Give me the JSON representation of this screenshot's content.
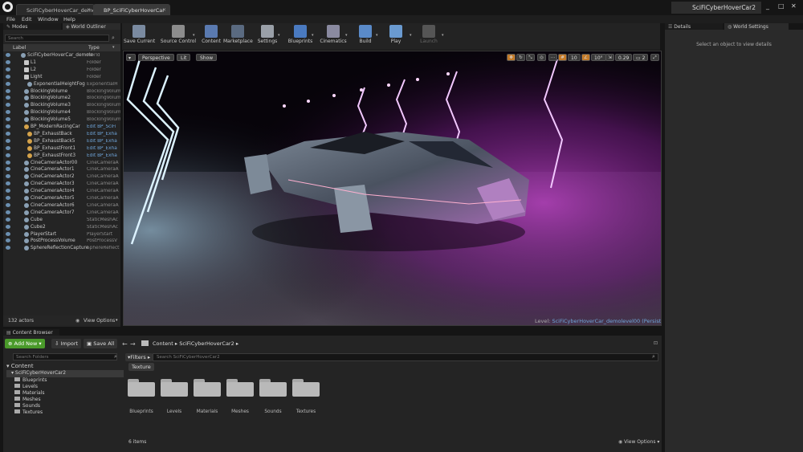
{
  "titlebar": {
    "tab_level": "SciFiCyberHoverCar_demolevel",
    "tab_bp": "BP_SciFiCyberHoverCar",
    "project_name": "SciFiCyberHoverCar2"
  },
  "menu": [
    "File",
    "Edit",
    "Window",
    "Help"
  ],
  "left_tabs": {
    "modes": "Modes",
    "outliner": "World Outliner"
  },
  "outliner": {
    "search_placeholder": "Search",
    "col_label": "Label",
    "col_type": "Type",
    "rows": [
      {
        "label": "SciFiCyberHoverCar_demole",
        "type": "World"
      },
      {
        "label": "L1",
        "type": "Folder"
      },
      {
        "label": "L2",
        "type": "Folder"
      },
      {
        "label": "Light",
        "type": "Folder"
      },
      {
        "label": "ExponentialHeightFog",
        "type": "ExponentialH"
      },
      {
        "label": "BlockingVolume",
        "type": "BlockingVolum"
      },
      {
        "label": "BlockingVolume2",
        "type": "BlockingVolum"
      },
      {
        "label": "BlockingVolume3",
        "type": "BlockingVolum"
      },
      {
        "label": "BlockingVolume4",
        "type": "BlockingVolum"
      },
      {
        "label": "BlockingVolume5",
        "type": "BlockingVolum"
      },
      {
        "label": "BP_ModernRacingCar",
        "type": "Edit BP_SciFi"
      },
      {
        "label": "BP_ExhaustBack",
        "type": "Edit BP_Exha"
      },
      {
        "label": "BP_ExhaustBack5",
        "type": "Edit BP_Exha"
      },
      {
        "label": "BP_ExhaustFront1",
        "type": "Edit BP_Exha"
      },
      {
        "label": "BP_ExhaustFront3",
        "type": "Edit BP_Exha"
      },
      {
        "label": "CineCameraActor00",
        "type": "CineCameraA"
      },
      {
        "label": "CineCameraActor1",
        "type": "CineCameraA"
      },
      {
        "label": "CineCameraActor2",
        "type": "CineCameraA"
      },
      {
        "label": "CineCameraActor3",
        "type": "CineCameraA"
      },
      {
        "label": "CineCameraActor4",
        "type": "CineCameraA"
      },
      {
        "label": "CineCameraActor5",
        "type": "CineCameraA"
      },
      {
        "label": "CineCameraActor6",
        "type": "CineCameraA"
      },
      {
        "label": "CineCameraActor7",
        "type": "CineCameraA"
      },
      {
        "label": "Cube",
        "type": "StaticMeshAc"
      },
      {
        "label": "Cube2",
        "type": "StaticMeshAc"
      },
      {
        "label": "PlayerStart",
        "type": "PlayerStart"
      },
      {
        "label": "PostProcessVolume",
        "type": "PostProcessV"
      },
      {
        "label": "SphereReflectionCapture",
        "type": "SphereReflect"
      }
    ],
    "actor_count": "132 actors",
    "view_options": "View Options"
  },
  "toolbar": [
    {
      "label": "Save Current",
      "icon": "save-icon"
    },
    {
      "label": "Source Control",
      "icon": "source-control-icon"
    },
    {
      "label": "Content",
      "icon": "content-icon"
    },
    {
      "label": "Marketplace",
      "icon": "marketplace-icon"
    },
    {
      "label": "Settings",
      "icon": "gear-icon"
    },
    {
      "label": "Blueprints",
      "icon": "blueprint-icon"
    },
    {
      "label": "Cinematics",
      "icon": "clapper-icon"
    },
    {
      "label": "Build",
      "icon": "build-icon"
    },
    {
      "label": "Play",
      "icon": "play-icon"
    },
    {
      "label": "Launch",
      "icon": "launch-icon"
    }
  ],
  "viewport": {
    "perspective": "Perspective",
    "lit": "Lit",
    "show": "Show",
    "grid_snap": "10",
    "rot_snap": "10°",
    "scale_snap": "0.29",
    "camera_speed": "2",
    "level_prefix": "Level:",
    "level_name": "SciFiCyberHoverCar_demolevel00 (Persistent)"
  },
  "right_tabs": {
    "details": "Details",
    "world_settings": "World Settings"
  },
  "details_hint": "Select an object to view details",
  "content_browser": {
    "tab": "Content Browser",
    "add_new": "Add New",
    "import": "Import",
    "save_all": "Save All",
    "path": [
      "Content",
      "SciFiCyberHoverCar2"
    ],
    "search_folders": "Search Folders",
    "filters": "Filters",
    "search_placeholder": "Search SciFiCyberHoverCar2",
    "filter_chip": "Texture",
    "tree_root": "Content",
    "tree_project": "SciFiCyberHoverCar2",
    "tree_children": [
      "Blueprints",
      "Levels",
      "Materials",
      "Meshes",
      "Sounds",
      "Textures"
    ],
    "folders": [
      "Blueprints",
      "Levels",
      "Materials",
      "Meshes",
      "Sounds",
      "Textures"
    ],
    "item_count": "6 items",
    "view_options": "View Options"
  },
  "colors": {
    "accent_green": "#4a9a2a",
    "link_blue": "#6fa4d8",
    "neon_pink": "#e060ff",
    "gizmo_orange": "#e08a2a"
  }
}
